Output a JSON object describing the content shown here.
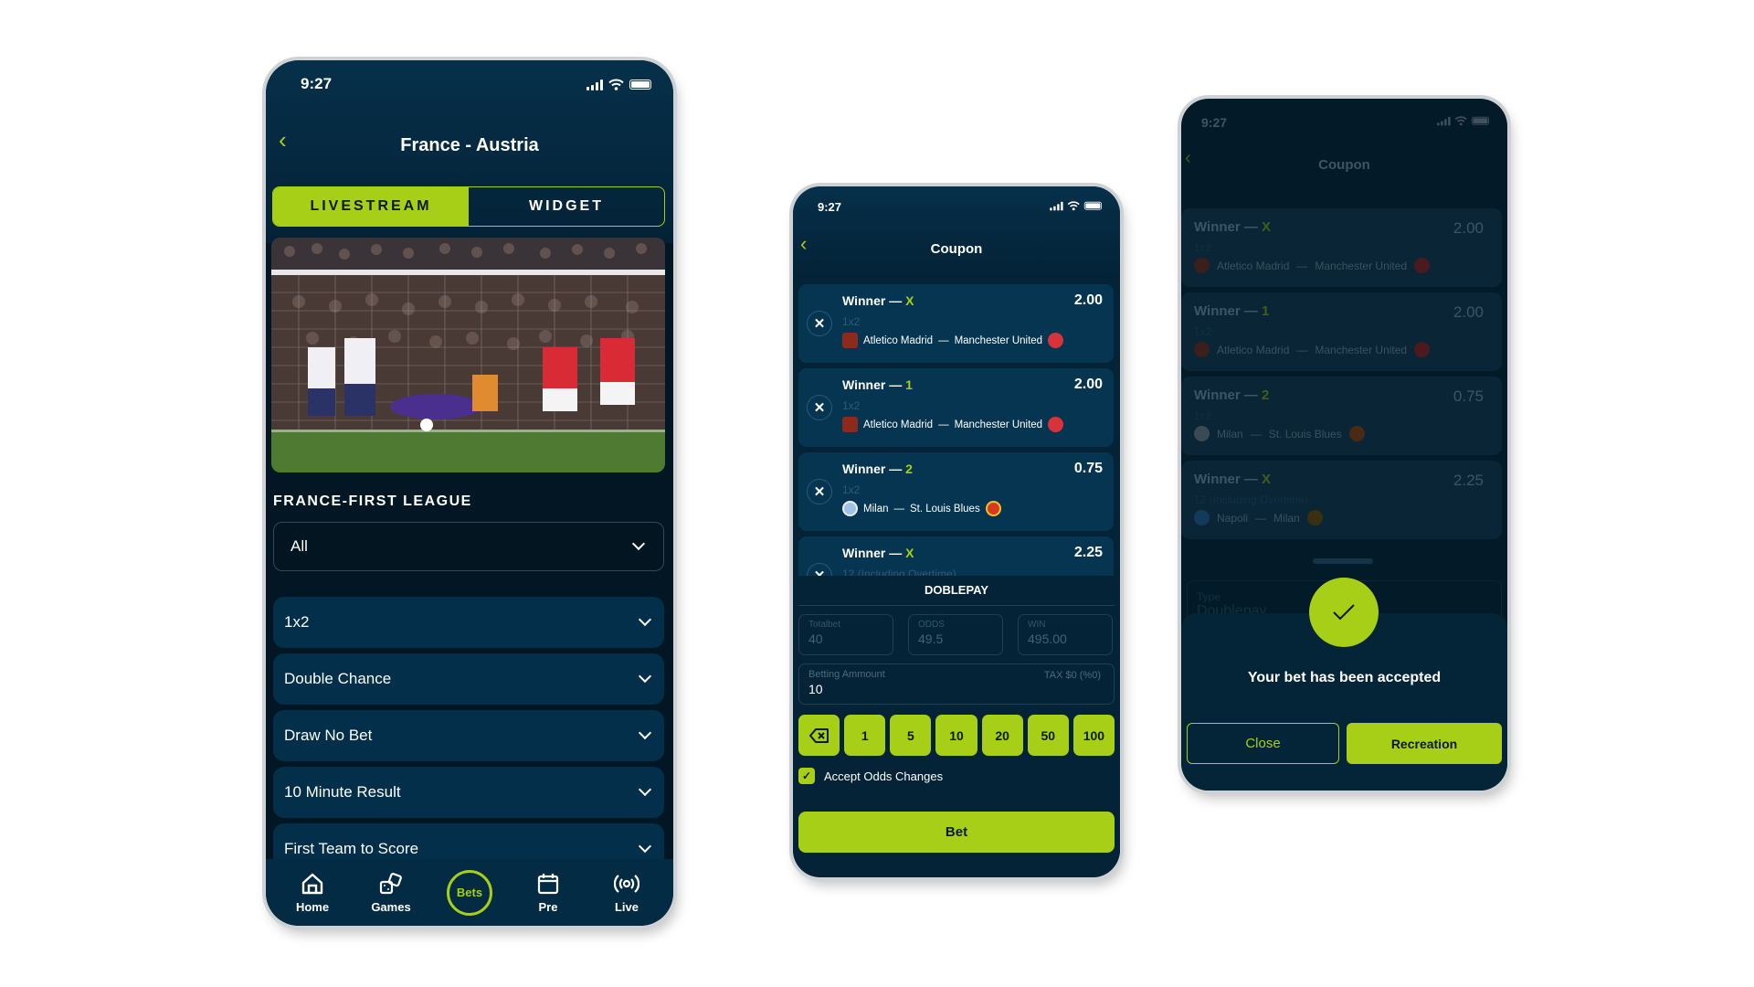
{
  "colors": {
    "accent": "#a7cf17",
    "bg_dark": "#021723",
    "card": "#032f4a"
  },
  "status": {
    "time": "9:27"
  },
  "screen1": {
    "title": "France - Austria",
    "tabs": [
      {
        "label": "LIVESTREAM",
        "active": true
      },
      {
        "label": "WIDGET",
        "active": false
      }
    ],
    "league": "FRANCE-FIRST LEAGUE",
    "filter": {
      "selected": "All"
    },
    "markets": [
      "1x2",
      "Double Chance",
      "Draw No Bet",
      "10 Minute Result",
      "First Team to Score"
    ],
    "nav": [
      {
        "label": "Home",
        "icon": "home-icon"
      },
      {
        "label": "Games",
        "icon": "dice-icon"
      },
      {
        "label": "Bets",
        "icon": "bets-circle"
      },
      {
        "label": "Pre",
        "icon": "calendar-icon"
      },
      {
        "label": "Live",
        "icon": "live-broadcast-icon"
      }
    ]
  },
  "screen2": {
    "title": "Coupon",
    "bets": [
      {
        "market": "Winner",
        "pick": "X",
        "odd": "2.00",
        "type": "1x2",
        "home": "Atletico Madrid",
        "away": "Manchester United"
      },
      {
        "market": "Winner",
        "pick": "1",
        "odd": "2.00",
        "type": "1x2",
        "home": "Atletico Madrid",
        "away": "Manchester United"
      },
      {
        "market": "Winner",
        "pick": "2",
        "odd": "0.75",
        "type": "1x2",
        "home": "Milan",
        "away": "St. Louis Blues"
      },
      {
        "market": "Winner",
        "pick": "X",
        "odd": "2.25",
        "type": "12 (Including Overtime)",
        "home": "Napoli",
        "away": "Milan"
      }
    ],
    "dash": "—",
    "bet_type": "DOBLEPAY",
    "totalbet": {
      "label": "Totalbet",
      "value": "40"
    },
    "odds": {
      "label": "ODDS",
      "value": "49.5"
    },
    "win": {
      "label": "WIN",
      "value": "495.00"
    },
    "amount": {
      "label": "Betting Ammount",
      "value": "10",
      "tax": "TAX $0 (%0)"
    },
    "quick_amounts": [
      "1",
      "5",
      "10",
      "20",
      "50",
      "100"
    ],
    "accept_odds": {
      "label": "Accept Odds Changes",
      "checked": true
    },
    "bet_button": "Bet"
  },
  "screen3": {
    "title": "Coupon",
    "type": {
      "label": "Type",
      "value": "Doublepay"
    },
    "message": "Your bet has been accepted",
    "close_button": "Close",
    "recreation_button": "Recreation"
  }
}
